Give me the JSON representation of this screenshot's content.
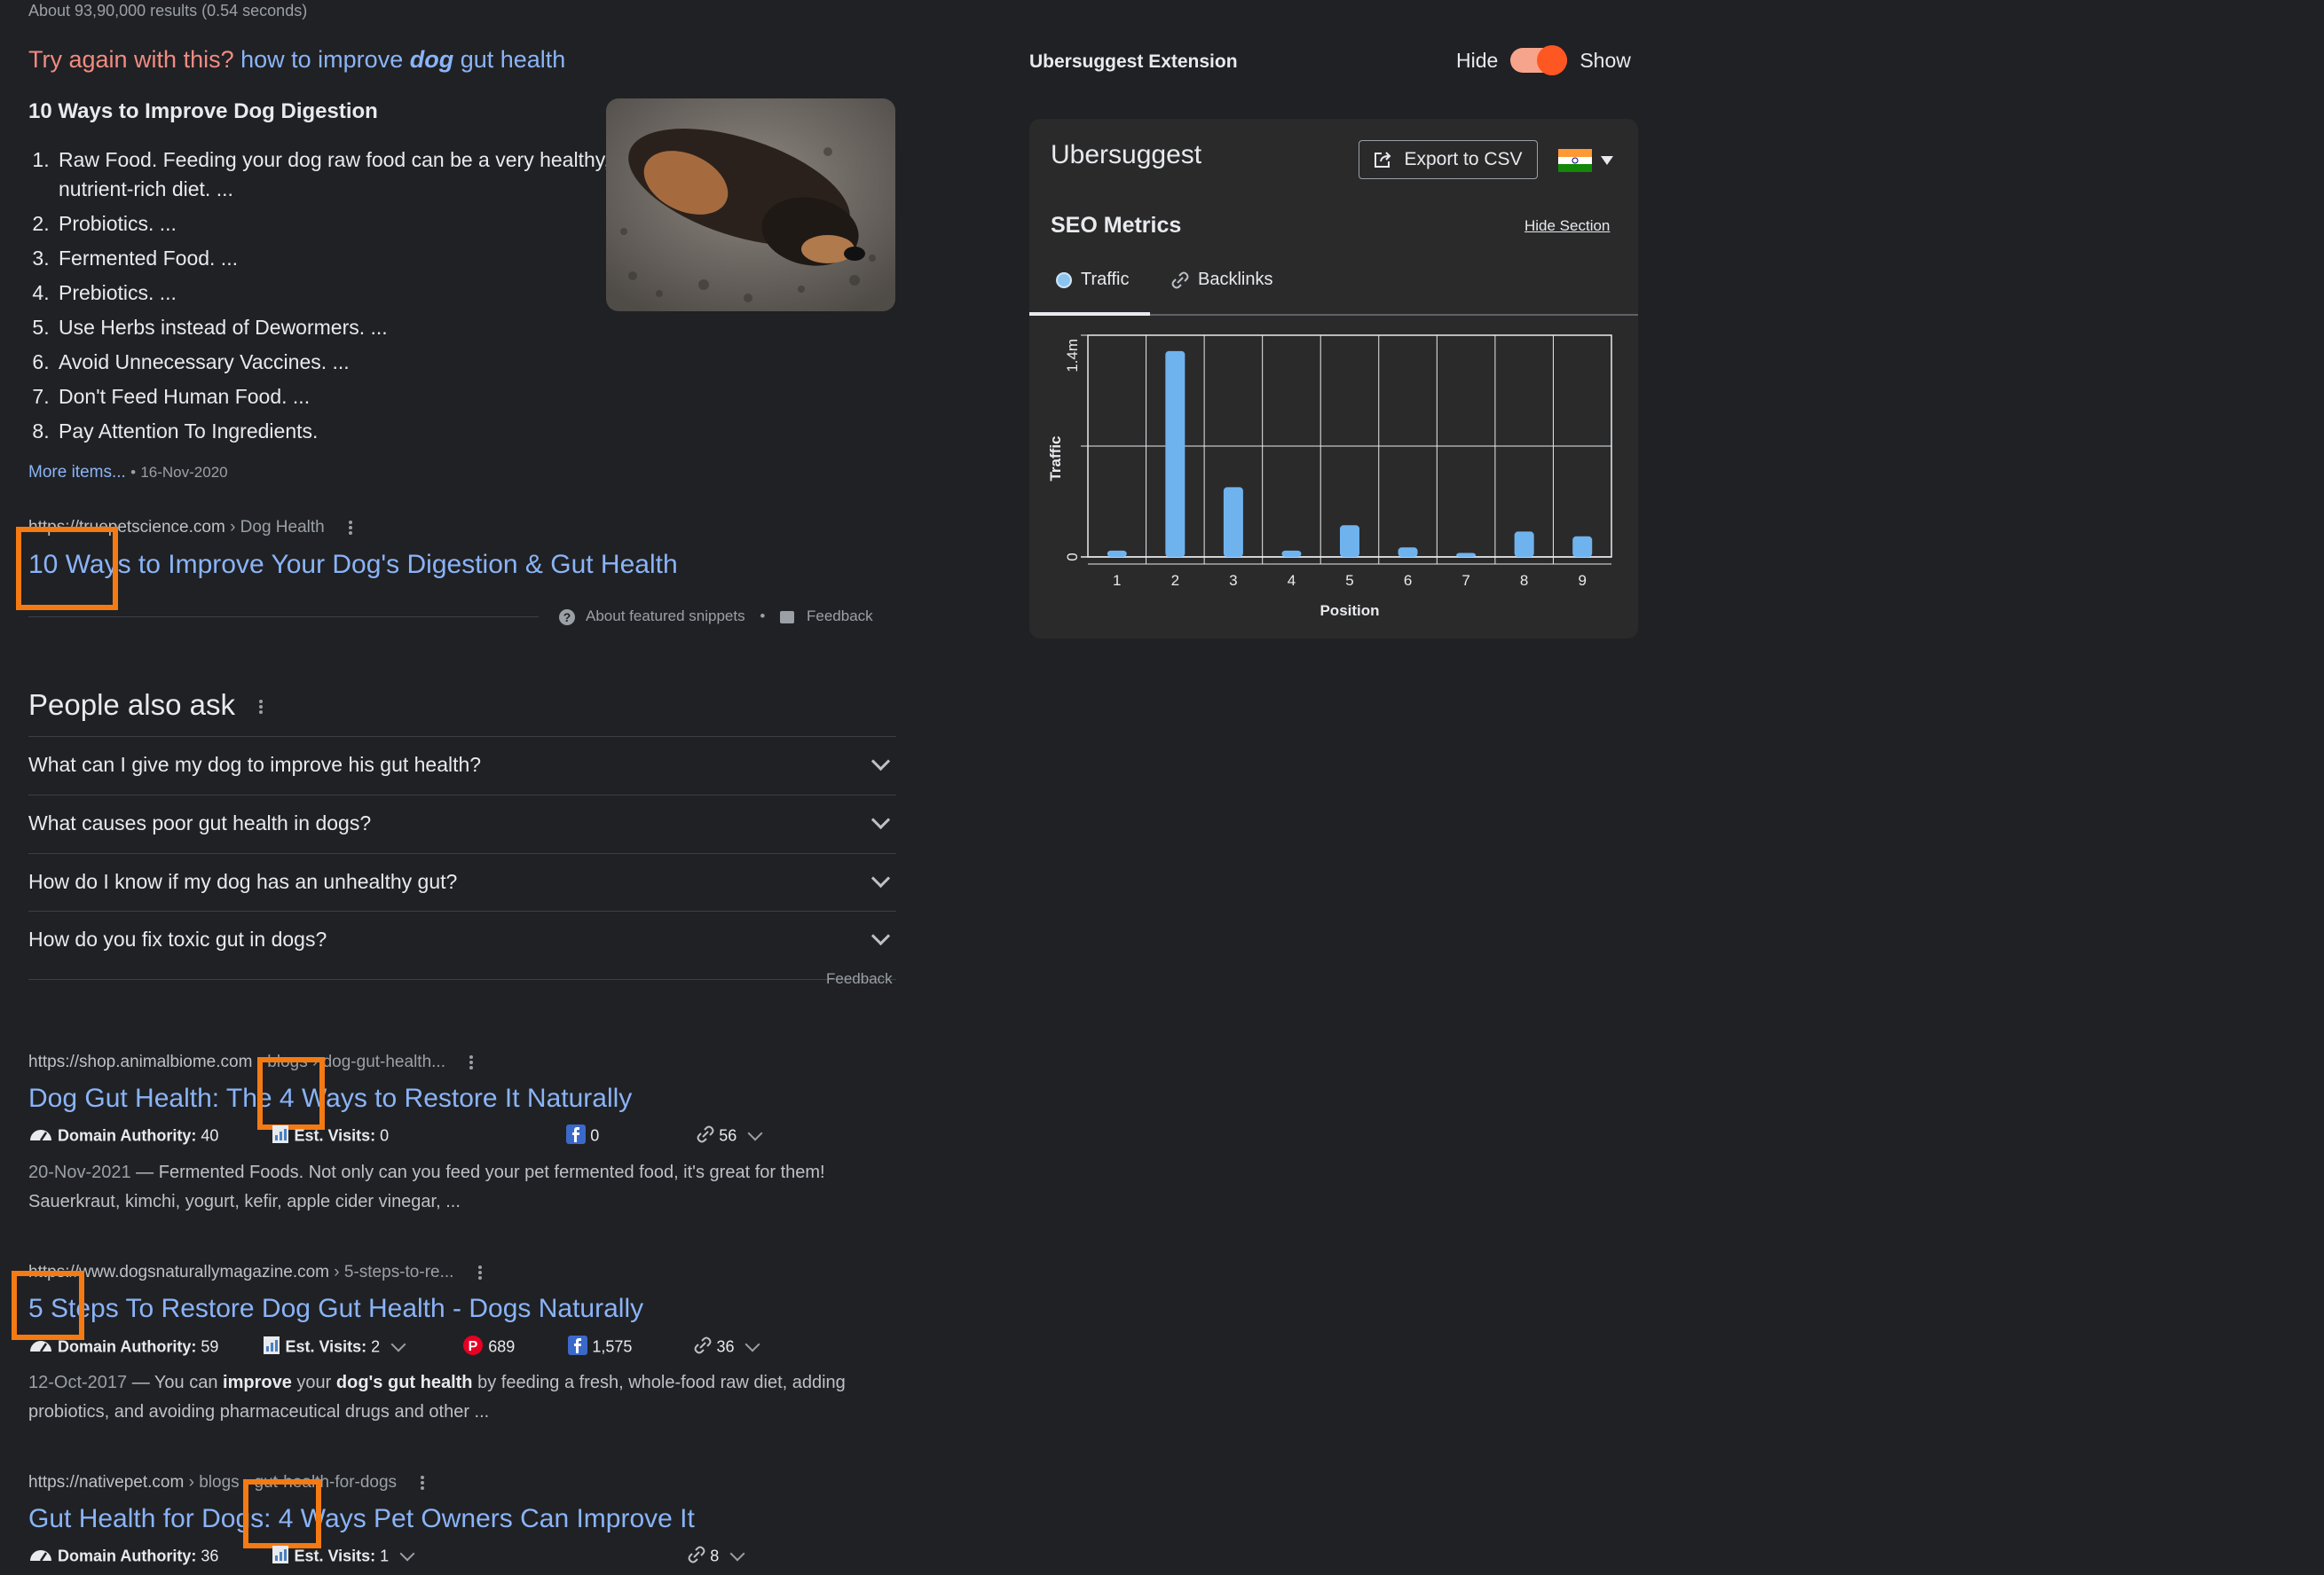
{
  "search": {
    "stats": "About 93,90,000 results (0.54 seconds)",
    "try_again_prefix": "Try again with this?",
    "suggest_before": "how to improve ",
    "suggest_bold": "dog",
    "suggest_after": " gut health"
  },
  "featured": {
    "title": "10 Ways to Improve Dog Digestion",
    "items": [
      "Raw Food. Feeding your dog raw food can be a very healthy, nutrient-rich diet. ...",
      "Probiotics. ...",
      "Fermented Food. ...",
      "Prebiotics. ...",
      "Use Herbs instead of Dewormers. ...",
      "Avoid Unnecessary Vaccines. ...",
      "Don't Feed Human Food. ...",
      "Pay Attention To Ingredients."
    ],
    "more_items": "More items...",
    "bullet": "•",
    "date": "16-Nov-2020",
    "url_domain": "https://truepetscience.com",
    "url_crumb": "› Dog Health",
    "result_title": "10 Ways to Improve Your Dog's Digestion & Gut Health",
    "about_label": "About featured snippets",
    "sep": "•",
    "feedback_label": "Feedback"
  },
  "paa": {
    "title": "People also ask",
    "questions": [
      "What can I give my dog to improve his gut health?",
      "What causes poor gut health in dogs?",
      "How do I know if my dog has an unhealthy gut?",
      "How do you fix toxic gut in dogs?"
    ],
    "feedback_label": "Feedback"
  },
  "results": [
    {
      "url_domain": "https://shop.animalbiome.com",
      "url_crumb": "› blogs › dog-gut-health...",
      "title": "Dog Gut Health: The 4 Ways to Restore It Naturally",
      "da_label": "Domain Authority:",
      "da": "40",
      "visits_label": "Est. Visits:",
      "visits": "0",
      "facebook": "0",
      "links": "56",
      "snippet_date": "20-Nov-2021",
      "snippet": " — Fermented Foods. Not only can you feed your pet fermented food, it's great for them! Sauerkraut, kimchi, yogurt, kefir, apple cider vinegar, ..."
    },
    {
      "url_domain": "https://www.dogsnaturallymagazine.com",
      "url_crumb": "› 5-steps-to-re...",
      "title": "5 Steps To Restore Dog Gut Health - Dogs Naturally",
      "da_label": "Domain Authority:",
      "da": "59",
      "visits_label": "Est. Visits:",
      "visits": "2",
      "pinterest": "689",
      "facebook": "1,575",
      "links": "36",
      "snippet_date": "12-Oct-2017",
      "snippet_a": " — You can ",
      "snippet_b1": "improve",
      "snippet_c": " your ",
      "snippet_b2": "dog's gut health",
      "snippet_d": " by feeding a fresh, whole-food raw diet, adding probiotics, and avoiding pharmaceutical drugs and other ..."
    },
    {
      "url_domain": "https://nativepet.com",
      "url_crumb": "› blogs › gut-health-for-dogs",
      "title": "Gut Health for Dogs: 4 Ways Pet Owners Can Improve It",
      "da_label": "Domain Authority:",
      "da": "36",
      "visits_label": "Est. Visits:",
      "visits": "1",
      "links": "8"
    }
  ],
  "extension": {
    "title": "Ubersuggest Extension",
    "hide_label": "Hide",
    "show_label": "Show",
    "toggle_on": true,
    "panel_title": "Ubersuggest",
    "export_label": "Export to CSV",
    "country_flag": "india-flag-icon",
    "seo_title": "SEO Metrics",
    "hide_section": "Hide Section",
    "tab_traffic": "Traffic",
    "tab_backlinks": "Backlinks",
    "accent": "#ff5722",
    "bar_color": "#6fb3ee"
  },
  "highlight_color": "#f47a13",
  "chart_data": {
    "type": "bar",
    "categories": [
      "1",
      "2",
      "3",
      "4",
      "5",
      "6",
      "7",
      "8",
      "9"
    ],
    "values": [
      40000,
      1300000,
      440000,
      40000,
      200000,
      60000,
      25000,
      160000,
      130000
    ],
    "xlabel": "Position",
    "ylabel": "Traffic",
    "yticks": [
      "0",
      "1.4m"
    ],
    "ylim": [
      0,
      1400000
    ],
    "grid": true
  }
}
